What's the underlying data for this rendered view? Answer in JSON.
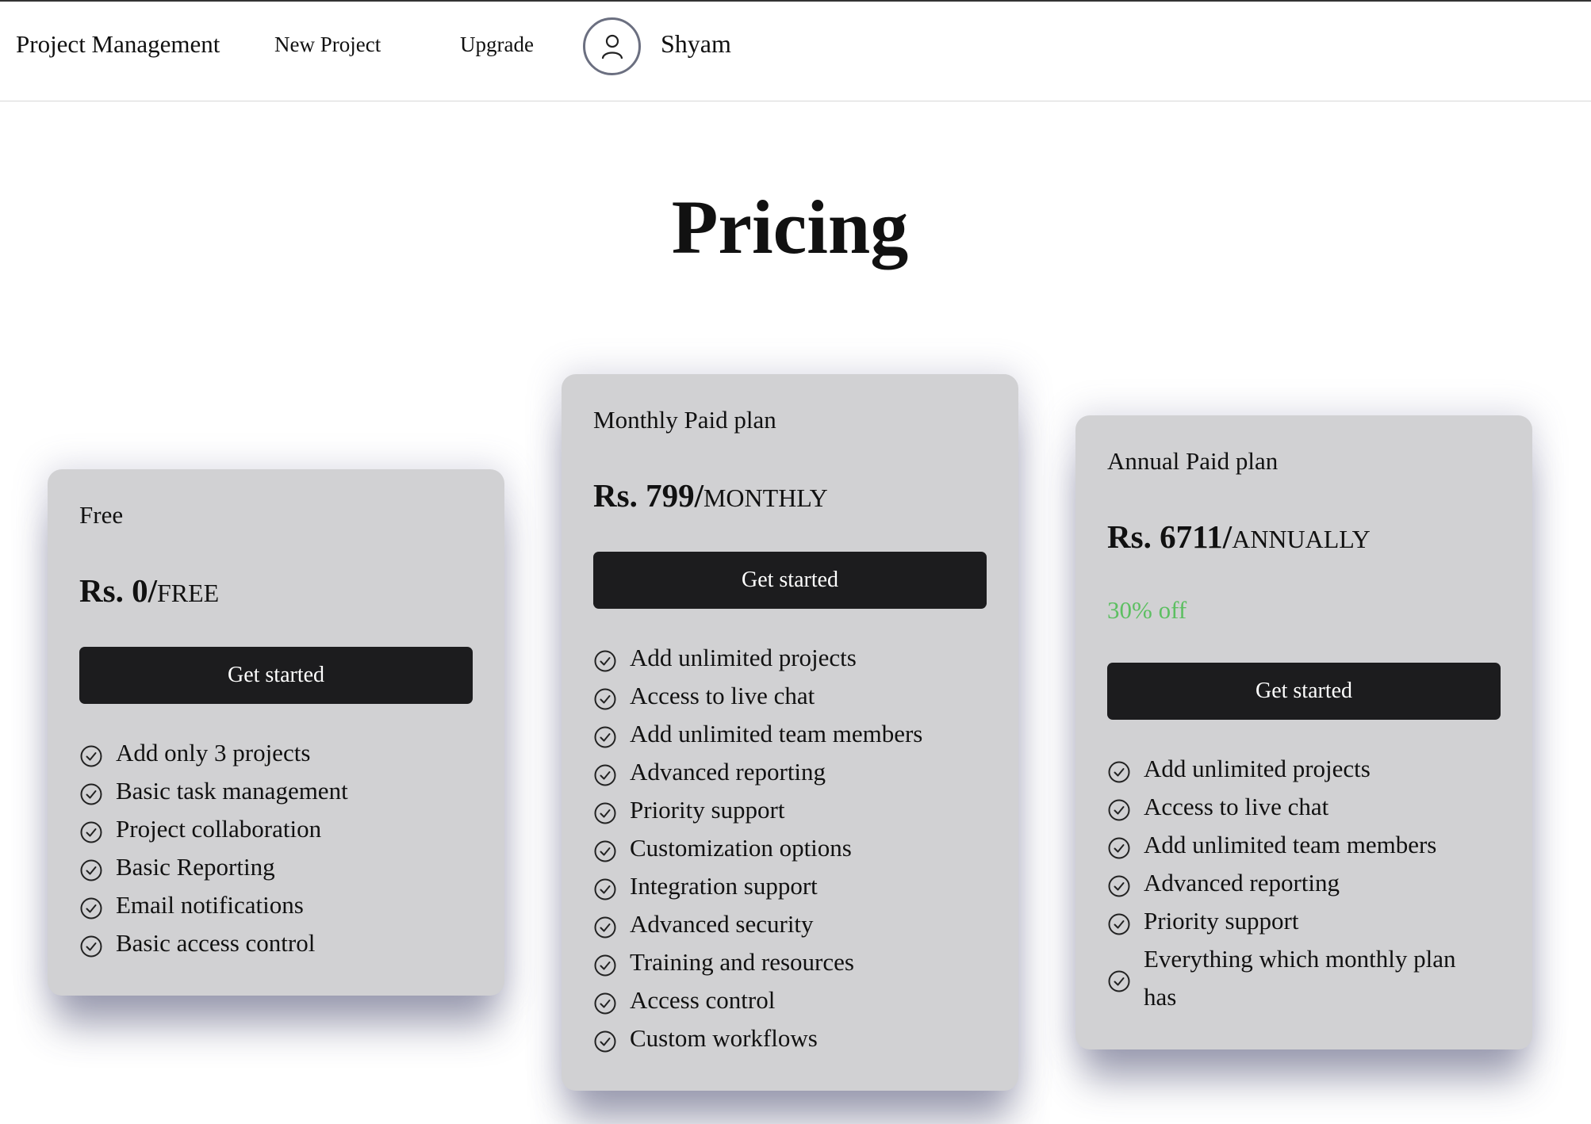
{
  "nav": {
    "brand": "Project Management",
    "new_project": "New Project",
    "upgrade": "Upgrade",
    "avatar_icon": "user-icon",
    "user_name": "Shyam"
  },
  "page": {
    "title": "Pricing"
  },
  "colors": {
    "card_bg": "#d1d1d3",
    "button_bg": "#1c1c1e",
    "discount": "#5cbf61"
  },
  "plans": [
    {
      "name": "Free",
      "price_amount": "Rs. 0/",
      "price_period": "FREE",
      "cta": "Get started",
      "features": [
        "Add only 3 projects",
        "Basic task management",
        "Project collaboration",
        "Basic Reporting",
        "Email notifications",
        "Basic access control"
      ]
    },
    {
      "name": "Monthly Paid plan",
      "price_amount": "Rs. 799/",
      "price_period": "MONTHLY",
      "cta": "Get started",
      "features": [
        "Add unlimited projects",
        "Access to live chat",
        "Add unlimited team members",
        "Advanced reporting",
        "Priority support",
        "Customization options",
        "Integration support",
        "Advanced security",
        "Training and resources",
        "Access control",
        "Custom workflows"
      ]
    },
    {
      "name": "Annual Paid plan",
      "price_amount": "Rs. 6711/",
      "price_period": "ANNUALLY",
      "discount": "30% off",
      "cta": "Get started",
      "features": [
        "Add unlimited projects",
        "Access to live chat",
        "Add unlimited team members",
        "Advanced reporting",
        "Priority support",
        "Everything which monthly plan has"
      ]
    }
  ],
  "feature_icon": "check-circle-icon"
}
